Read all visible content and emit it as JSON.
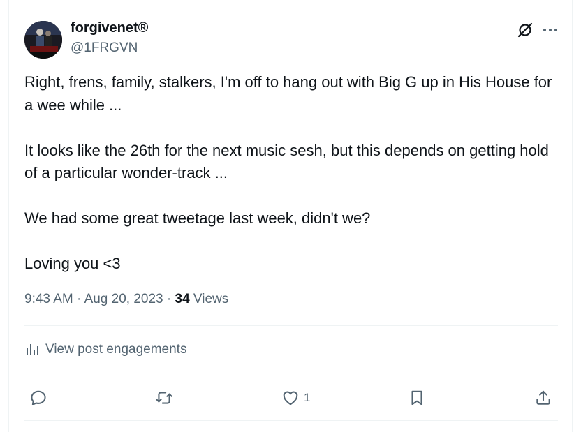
{
  "user": {
    "display_name": "forgivenet®",
    "handle": "@1FRGVN"
  },
  "post": {
    "paragraphs": [
      "Right, frens, family, stalkers, I'm off to hang out with Big G up in His House for a wee while ...",
      "It looks like the 26th for the next music sesh, but this depends on getting hold of a particular wonder-track ...",
      "We had some great tweetage last week, didn't we?",
      "Loving you <3"
    ],
    "time": "9:43 AM",
    "date": "Aug 20, 2023",
    "views_count": "34",
    "views_label": "Views",
    "separator": "·"
  },
  "engagements_label": "View post engagements",
  "actions": {
    "reply_count": "",
    "repost_count": "",
    "like_count": "1",
    "bookmark_count": ""
  },
  "colors": {
    "text": "#0f1419",
    "secondary": "#536471",
    "divider": "#eff3f4"
  },
  "icons": [
    "grok-icon",
    "more-icon",
    "avatar",
    "analytics-icon",
    "reply-icon",
    "repost-icon",
    "like-icon",
    "bookmark-icon",
    "share-icon"
  ]
}
